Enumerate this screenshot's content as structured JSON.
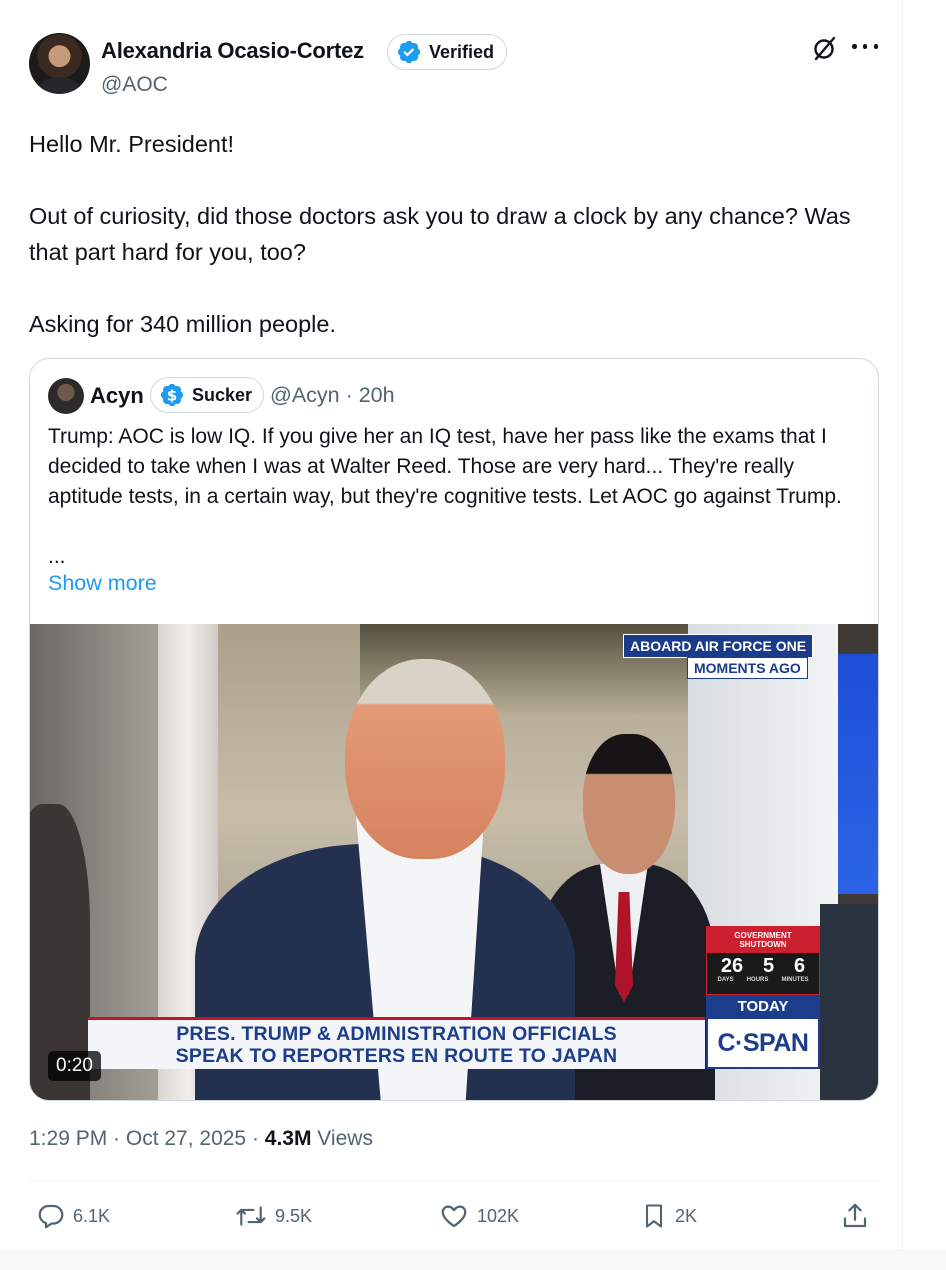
{
  "author": {
    "display_name": "Alexandria Ocasio-Cortez",
    "badge_label": "Verified",
    "handle": "@AOC"
  },
  "tweet": {
    "line1": "Hello Mr. President!",
    "line2": "Out of curiosity, did those doctors ask you to draw a clock by any chance? Was that part hard for you, too?",
    "line3": "Asking for 340 million people."
  },
  "quote": {
    "name": "Acyn",
    "badge_label": "Sucker",
    "meta": "@Acyn · 20h",
    "text": "Trump: AOC is low IQ. If you give her an IQ test, have her pass like the exams that I decided to take when I was at Walter Reed. Those are very hard... They're really aptitude tests, in a certain way, but they're cognitive tests. Let AOC go against Trump.",
    "ellipsis": "...",
    "show_more": "Show more",
    "video": {
      "location_tag": "ABOARD AIR FORCE ONE",
      "time_tag": "MOMENTS AGO",
      "headline_line1": "PRES. TRUMP & ADMINISTRATION OFFICIALS",
      "headline_line2": "SPEAK TO REPORTERS EN ROUTE TO JAPAN",
      "network": "C·SPAN",
      "today": "TODAY",
      "shutdown_label_1": "GOVERNMENT",
      "shutdown_label_2": "SHUTDOWN",
      "shutdown_days": "26",
      "shutdown_hours": "5",
      "shutdown_minutes": "6",
      "unit_days": "DAYS",
      "unit_hours": "HOURS",
      "unit_minutes": "MINUTES",
      "duration": "0:20"
    }
  },
  "timestamp": {
    "time_date": "1:29 PM · Oct 27, 2025 · ",
    "views_count": "4.3M",
    "views_label": " Views"
  },
  "actions": {
    "replies": "6.1K",
    "reposts": "9.5K",
    "likes": "102K",
    "bookmarks": "2K"
  },
  "colors": {
    "accent": "#1d9bf0",
    "secondary_text": "#536471",
    "border": "#cfd9de",
    "cspan_blue": "#1c3d8c",
    "cspan_red": "#cc1f2f"
  }
}
